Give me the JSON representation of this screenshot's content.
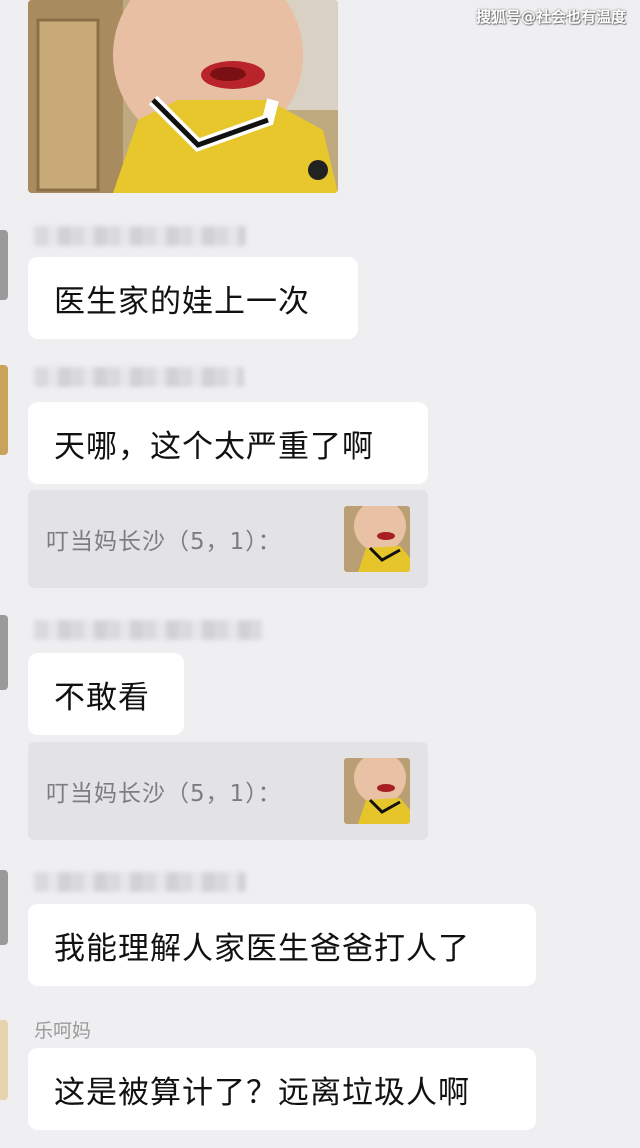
{
  "watermark": "搜狐号@社会也有温度",
  "messages": [
    {
      "type": "text",
      "sender": "",
      "text": "医生家的娃上一次"
    },
    {
      "type": "text",
      "sender": "",
      "text": "天哪，这个太严重了啊"
    },
    {
      "type": "quote",
      "text": "叮当妈长沙（5，1）："
    },
    {
      "type": "text",
      "sender": "",
      "text": "不敢看"
    },
    {
      "type": "quote",
      "text": "叮当妈长沙（5，1）："
    },
    {
      "type": "text",
      "sender": "",
      "text": "我能理解人家医生爸爸打人了"
    },
    {
      "type": "text",
      "sender": "乐呵妈",
      "text": "这是被算计了？远离垃圾人啊"
    }
  ]
}
